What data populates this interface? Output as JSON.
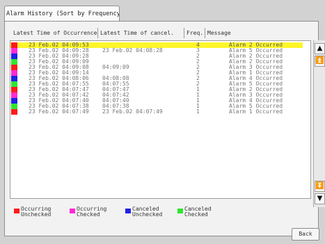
{
  "tab": {
    "label": "Alarm History (Sort by Frequency)"
  },
  "columns": [
    "Latest Time of Occurrence",
    "Latest Time of cancel.",
    "Freq.",
    "Message"
  ],
  "rows": [
    {
      "occurrence": "23 Feb.02  04:09:53",
      "cancel": "",
      "freq": "4",
      "message": "Alarm 2 Occurred",
      "status": "occurring-unchecked",
      "selected": true
    },
    {
      "occurrence": "23 Feb.02  04:09:28",
      "cancel": "23 Feb.02  04:08:28",
      "freq": "3",
      "message": "Alarm 5 Occurred",
      "status": "occurring-checked"
    },
    {
      "occurrence": "23 Feb.02  04:09:28",
      "cancel": "",
      "freq": "2",
      "message": "Alarm 2 Occurred",
      "status": "canceled-unchecked"
    },
    {
      "occurrence": "23 Feb.02  04:09:09",
      "cancel": "",
      "freq": "2",
      "message": "Alarm 2 Occurred",
      "status": "canceled-checked"
    },
    {
      "occurrence": "23 Feb.02  04:09:08",
      "cancel": "04:09:09",
      "freq": "2",
      "message": "Alarm 3 Occurred",
      "status": "occurring-unchecked"
    },
    {
      "occurrence": "23 Feb.02  04:09:14",
      "cancel": "",
      "freq": "2",
      "message": "Alarm 1 Occurred",
      "status": "occurring-checked"
    },
    {
      "occurrence": "23 Feb.02  04:08:06",
      "cancel": "04:08:08",
      "freq": "2",
      "message": "Alarm 4 Occurred",
      "status": "canceled-unchecked"
    },
    {
      "occurrence": "23 Feb.02  04:07:55",
      "cancel": "04:07:55",
      "freq": "2",
      "message": "Alarm 5 Occurred",
      "status": "canceled-checked"
    },
    {
      "occurrence": "23 Feb.02  04:07:47",
      "cancel": "04:07:47",
      "freq": "1",
      "message": "Alarm 2 Occurred",
      "status": "occurring-unchecked"
    },
    {
      "occurrence": "23 Feb.02  04:07:42",
      "cancel": "04:07:42",
      "freq": "1",
      "message": "Alarm 3 Occurred",
      "status": "occurring-checked"
    },
    {
      "occurrence": "23 Feb.02  04:07:40",
      "cancel": "04:07:40",
      "freq": "1",
      "message": "Alarm 4 Occurred",
      "status": "canceled-unchecked"
    },
    {
      "occurrence": "23 Feb.02  04:07:38",
      "cancel": "04:07:38",
      "freq": "1",
      "message": "Alarm 5 Occurred",
      "status": "canceled-checked"
    },
    {
      "occurrence": "23 Feb.02  04:07:49",
      "cancel": "23 Feb.02  04:07:49",
      "freq": "1",
      "message": "Alarm 1 Occurred",
      "status": "occurring-unchecked"
    }
  ],
  "legend": [
    {
      "status": "occurring-unchecked",
      "line1": "Occurring",
      "line2": "Unchecked",
      "color": "#ff1a1a"
    },
    {
      "status": "occurring-checked",
      "line1": "Occurring",
      "line2": "Checked",
      "color": "#ff2ad4"
    },
    {
      "status": "canceled-unchecked",
      "line1": "Canceled",
      "line2": "Unchecked",
      "color": "#1f1fe6"
    },
    {
      "status": "canceled-checked",
      "line1": "Canceled",
      "line2": "Checked",
      "color": "#2ee62e"
    }
  ],
  "scroll": {
    "up_icon": "arrow-up-icon",
    "page_up_icon": "double-arrow-up-icon",
    "page_down_icon": "double-arrow-down-icon",
    "down_icon": "arrow-down-icon"
  },
  "back_label": "Back"
}
